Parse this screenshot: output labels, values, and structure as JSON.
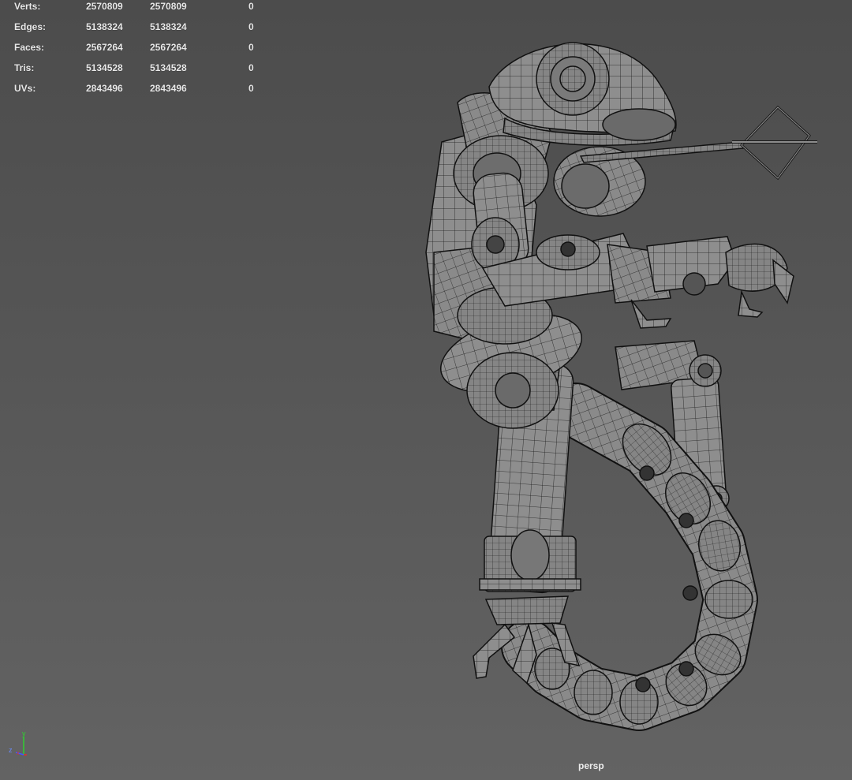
{
  "stats": [
    {
      "label": "Verts:",
      "v1": "2570809",
      "v2": "2570809",
      "v3": "0"
    },
    {
      "label": "Edges:",
      "v1": "5138324",
      "v2": "5138324",
      "v3": "0"
    },
    {
      "label": "Faces:",
      "v1": "2567264",
      "v2": "2567264",
      "v3": "0"
    },
    {
      "label": "Tris:",
      "v1": "5134528",
      "v2": "5134528",
      "v3": "0"
    },
    {
      "label": "UVs:",
      "v1": "2843496",
      "v2": "2843496",
      "v3": "0"
    }
  ],
  "camera": "persp",
  "axis": {
    "y": "y",
    "z": "z",
    "x": "x"
  },
  "colors": {
    "background_top": "#4c4c4c",
    "background_bottom": "#636363",
    "mesh_fill": "#8e8e8e",
    "wire": "#1a1a1a",
    "axis_x": "#e03030",
    "axis_y": "#30d030",
    "axis_z": "#3a5cff"
  }
}
